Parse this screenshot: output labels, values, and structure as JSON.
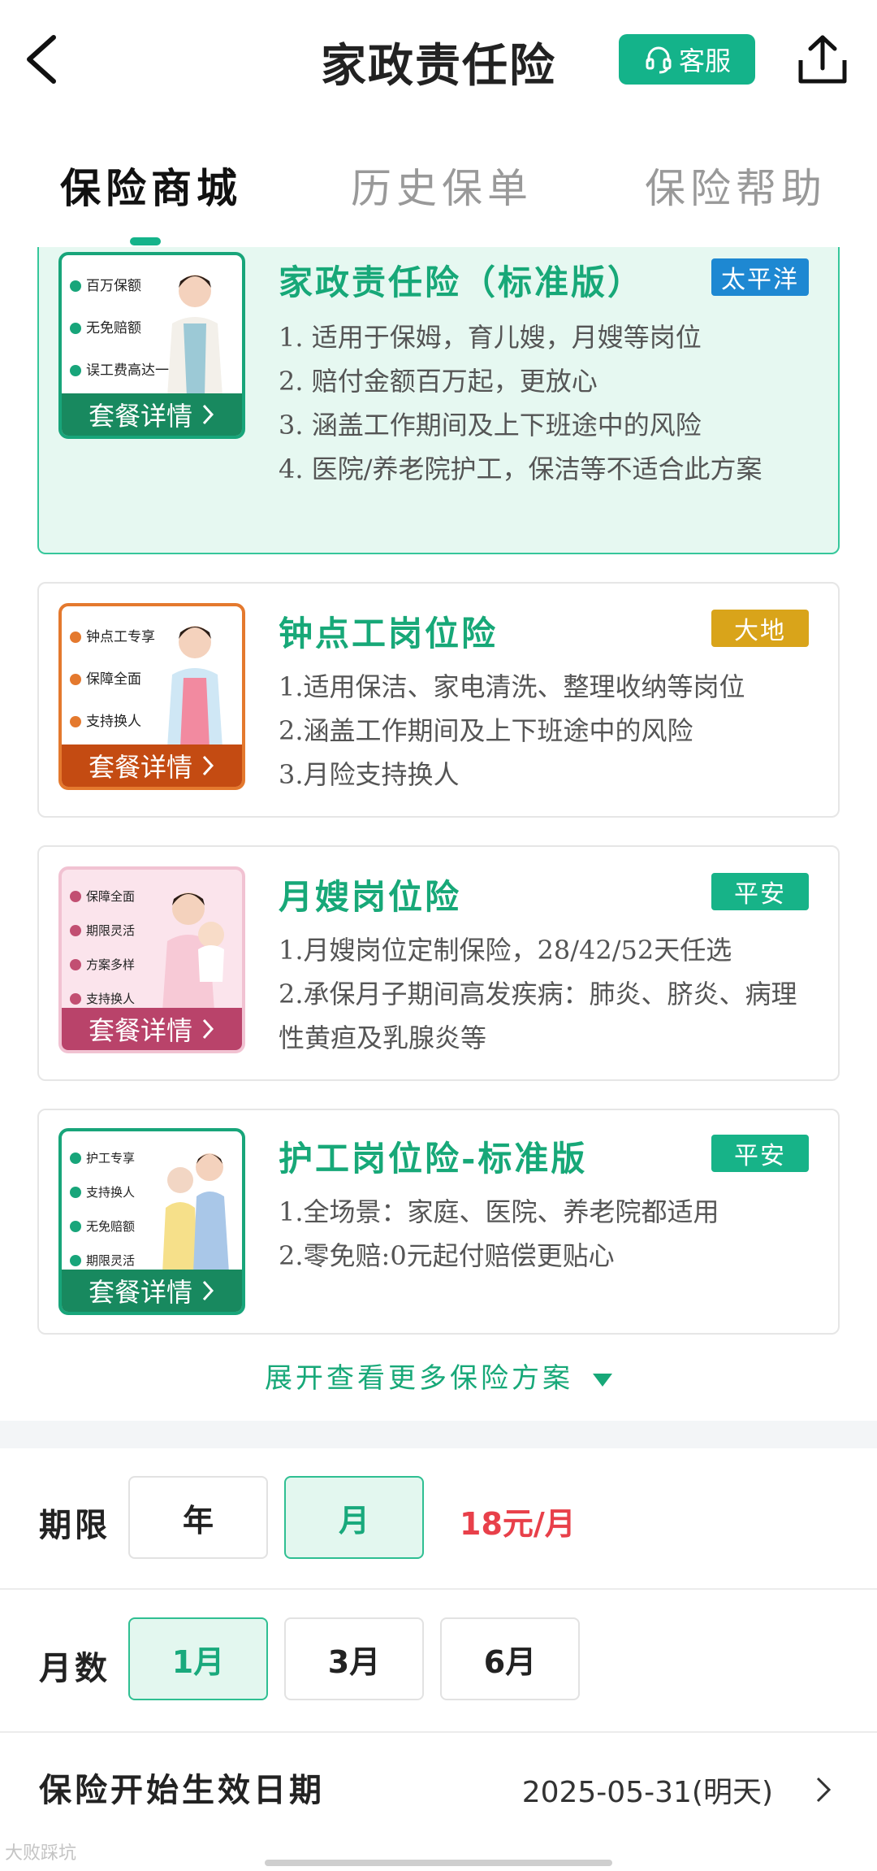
{
  "header": {
    "title": "家政责任险",
    "service_label": "客服"
  },
  "tabs": [
    {
      "label": "保险商城",
      "active": true
    },
    {
      "label": "历史保单",
      "active": false
    },
    {
      "label": "保险帮助",
      "active": false
    }
  ],
  "products": [
    {
      "title": "家政责任险（标准版）",
      "insurer": "太平洋",
      "insurer_color": "#1e88d2",
      "selected": true,
      "thumb_bullets": [
        "百万保额",
        "无免赔额",
        "误工费高达一年"
      ],
      "details_label": "套餐详情",
      "features": [
        "1. 适用于保姆，育儿嫂，月嫂等岗位",
        "2. 赔付金额百万起，更放心",
        "3. 涵盖工作期间及上下班途中的风险",
        "4. 医院/养老院护工，保洁等不适合此方案"
      ]
    },
    {
      "title": "钟点工岗位险",
      "insurer": "大地",
      "insurer_color": "#d9a41a",
      "selected": false,
      "thumb_bullets": [
        "钟点工专享",
        "保障全面",
        "支持换人"
      ],
      "details_label": "套餐详情",
      "features": [
        "1.适用保洁、家电清洗、整理收纳等岗位",
        "2.涵盖工作期间及上下班途中的风险",
        "3.月险支持换人"
      ]
    },
    {
      "title": "月嫂岗位险",
      "insurer": "平安",
      "insurer_color": "#17b388",
      "selected": false,
      "thumb_bullets": [
        "保障全面",
        "期限灵活",
        "方案多样",
        "支持换人"
      ],
      "details_label": "套餐详情",
      "features": [
        "1.月嫂岗位定制保险，28/42/52天任选",
        "2.承保月子期间高发疾病：肺炎、脐炎、病理性黄疸及乳腺炎等"
      ]
    },
    {
      "title": "护工岗位险-标准版",
      "insurer": "平安",
      "insurer_color": "#17b388",
      "selected": false,
      "thumb_bullets": [
        "护工专享",
        "支持换人",
        "无免赔额",
        "期限灵活"
      ],
      "details_label": "套餐详情",
      "features": [
        "1.全场景：家庭、医院、养老院都适用",
        "2.零免赔:0元起付赔偿更贴心"
      ]
    }
  ],
  "expand_label": "展开查看更多保险方案",
  "period": {
    "label": "期限",
    "options": [
      {
        "label": "年",
        "selected": false
      },
      {
        "label": "月",
        "selected": true
      }
    ],
    "price": "18元/月"
  },
  "months": {
    "label": "月数",
    "options": [
      {
        "label": "1月",
        "selected": true
      },
      {
        "label": "3月",
        "selected": false
      },
      {
        "label": "6月",
        "selected": false
      }
    ]
  },
  "start_date": {
    "label": "保险开始生效日期",
    "value": "2025-05-31(明天)"
  },
  "watermark": "大败踩坑"
}
